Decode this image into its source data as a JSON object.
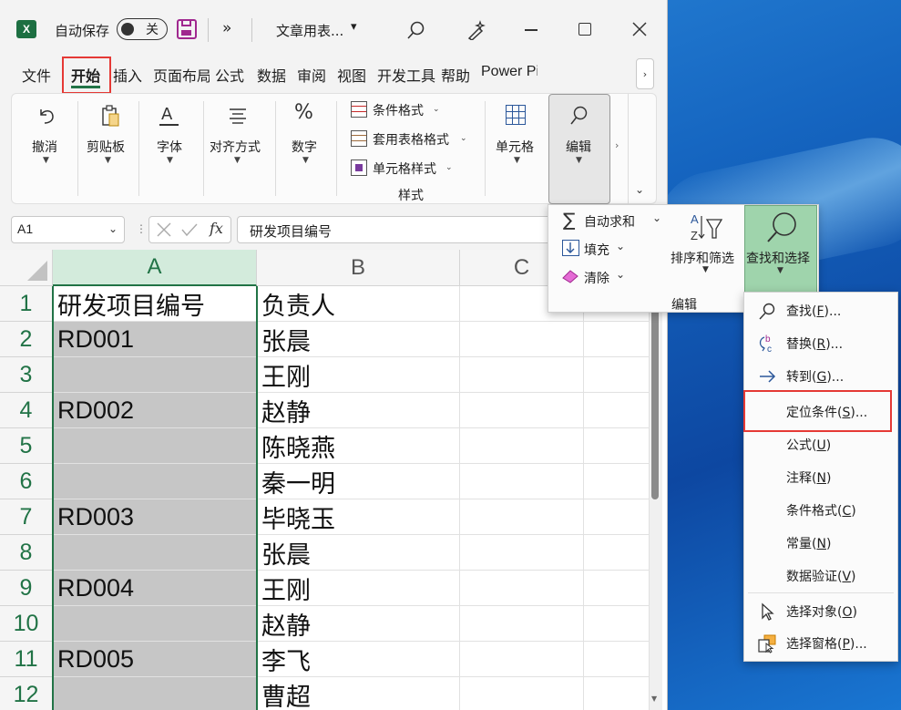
{
  "titlebar": {
    "autosave_label": "自动保存",
    "autosave_state": "关",
    "more": "»",
    "doc_title": "文章用表...",
    "title_dropdown": "▾"
  },
  "tabs": [
    "文件",
    "开始",
    "插入",
    "页面布局",
    "公式",
    "数据",
    "审阅",
    "视图",
    "开发工具",
    "帮助",
    "Power Pivot"
  ],
  "active_tab": "开始",
  "ribbon": {
    "undo": "撤消",
    "clipboard": "剪贴板",
    "font": "字体",
    "align": "对齐方式",
    "number": "数字",
    "cond_format": "条件格式",
    "table_format": "套用表格格式",
    "cell_style": "单元格样式",
    "styles_group": "样式",
    "cells": "单元格",
    "editing": "编辑"
  },
  "formula_bar": {
    "name_box": "A1",
    "fx": "fx",
    "content": "研发项目编号"
  },
  "columns": [
    "A",
    "B",
    "C"
  ],
  "rows": [
    {
      "n": "1",
      "a": "研发项目编号",
      "b": "负责人"
    },
    {
      "n": "2",
      "a": "RD001",
      "b": "张晨"
    },
    {
      "n": "3",
      "a": "",
      "b": "王刚"
    },
    {
      "n": "4",
      "a": "RD002",
      "b": "赵静"
    },
    {
      "n": "5",
      "a": "",
      "b": "陈晓燕"
    },
    {
      "n": "6",
      "a": "",
      "b": "秦一明"
    },
    {
      "n": "7",
      "a": "RD003",
      "b": "毕晓玉"
    },
    {
      "n": "8",
      "a": "",
      "b": "张晨"
    },
    {
      "n": "9",
      "a": "RD004",
      "b": "王刚"
    },
    {
      "n": "10",
      "a": "",
      "b": "赵静"
    },
    {
      "n": "11",
      "a": "RD005",
      "b": "李飞"
    },
    {
      "n": "12",
      "a": "",
      "b": "曹超"
    }
  ],
  "edit_panel": {
    "autosum": "自动求和",
    "fill": "填充",
    "clear": "清除",
    "sort_filter": "排序和筛选",
    "find_select": "查找和选择",
    "group": "编辑"
  },
  "find_menu": [
    {
      "label": "查找(F)...",
      "icon": "search-icon"
    },
    {
      "label": "替换(R)...",
      "icon": "replace-icon"
    },
    {
      "label": "转到(G)...",
      "icon": "arrow-right-icon"
    },
    {
      "label": "定位条件(S)...",
      "icon": ""
    },
    {
      "label": "公式(U)",
      "icon": ""
    },
    {
      "label": "注释(N)",
      "icon": ""
    },
    {
      "label": "条件格式(C)",
      "icon": ""
    },
    {
      "label": "常量(N)",
      "icon": ""
    },
    {
      "label": "数据验证(V)",
      "icon": ""
    },
    {
      "label": "选择对象(O)",
      "icon": "pointer-icon"
    },
    {
      "label": "选择窗格(P)...",
      "icon": "selection-pane-icon"
    }
  ],
  "colors": {
    "excel_green": "#217346",
    "highlight_red": "#e53935",
    "selected_fill": "#c6c6c6"
  }
}
